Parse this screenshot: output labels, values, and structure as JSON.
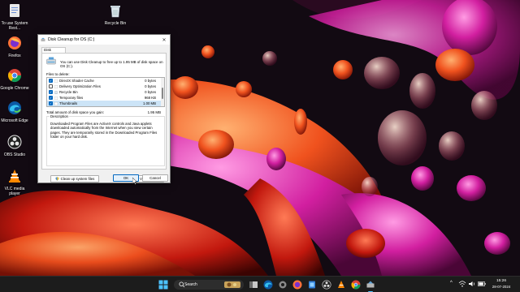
{
  "desktop": {
    "icons": [
      {
        "name": "to-use-system-restore",
        "label": "To use System Rest..."
      },
      {
        "name": "firefox",
        "label": "Firefox"
      },
      {
        "name": "google-chrome",
        "label": "Google Chrome"
      },
      {
        "name": "microsoft-edge",
        "label": "Microsoft Edge"
      },
      {
        "name": "obs-studio",
        "label": "OBS Studio"
      },
      {
        "name": "vlc-media-player",
        "label": "VLC media player"
      },
      {
        "name": "recycle-bin",
        "label": "Recycle Bin"
      }
    ]
  },
  "dialog": {
    "title": "Disk Cleanup for OS (C:)",
    "tab": "Disk Cleanup",
    "intro": "You can use Disk Cleanup to free up to 1.95 MB of disk space on OS (C:).",
    "files_label": "Files to delete:",
    "files": [
      {
        "name": "DirectX Shader Cache",
        "size": "0 bytes",
        "checked": true
      },
      {
        "name": "Delivery Optimization Files",
        "size": "0 bytes",
        "checked": false
      },
      {
        "name": "Recycle Bin",
        "size": "0 bytes",
        "checked": true
      },
      {
        "name": "Temporary files",
        "size": "968 KB",
        "checked": true
      },
      {
        "name": "Thumbnails",
        "size": "1.00 MB",
        "checked": true
      }
    ],
    "total_label": "Total amount of disk space you gain:",
    "total_value": "1.95 MB",
    "description_label": "Description",
    "description": "Downloaded Program Files are ActiveX controls and Java applets downloaded automatically from the Internet when you view certain pages. They are temporarily stored in the Downloaded Program Files folder on your hard disk.",
    "cleanup_system_label": "Clean up system files",
    "view_files_label": "View Files",
    "ok_label": "OK",
    "cancel_label": "Cancel"
  },
  "taskbar": {
    "search_placeholder": "Search",
    "time": "15:26",
    "date": "28-07-2024"
  }
}
